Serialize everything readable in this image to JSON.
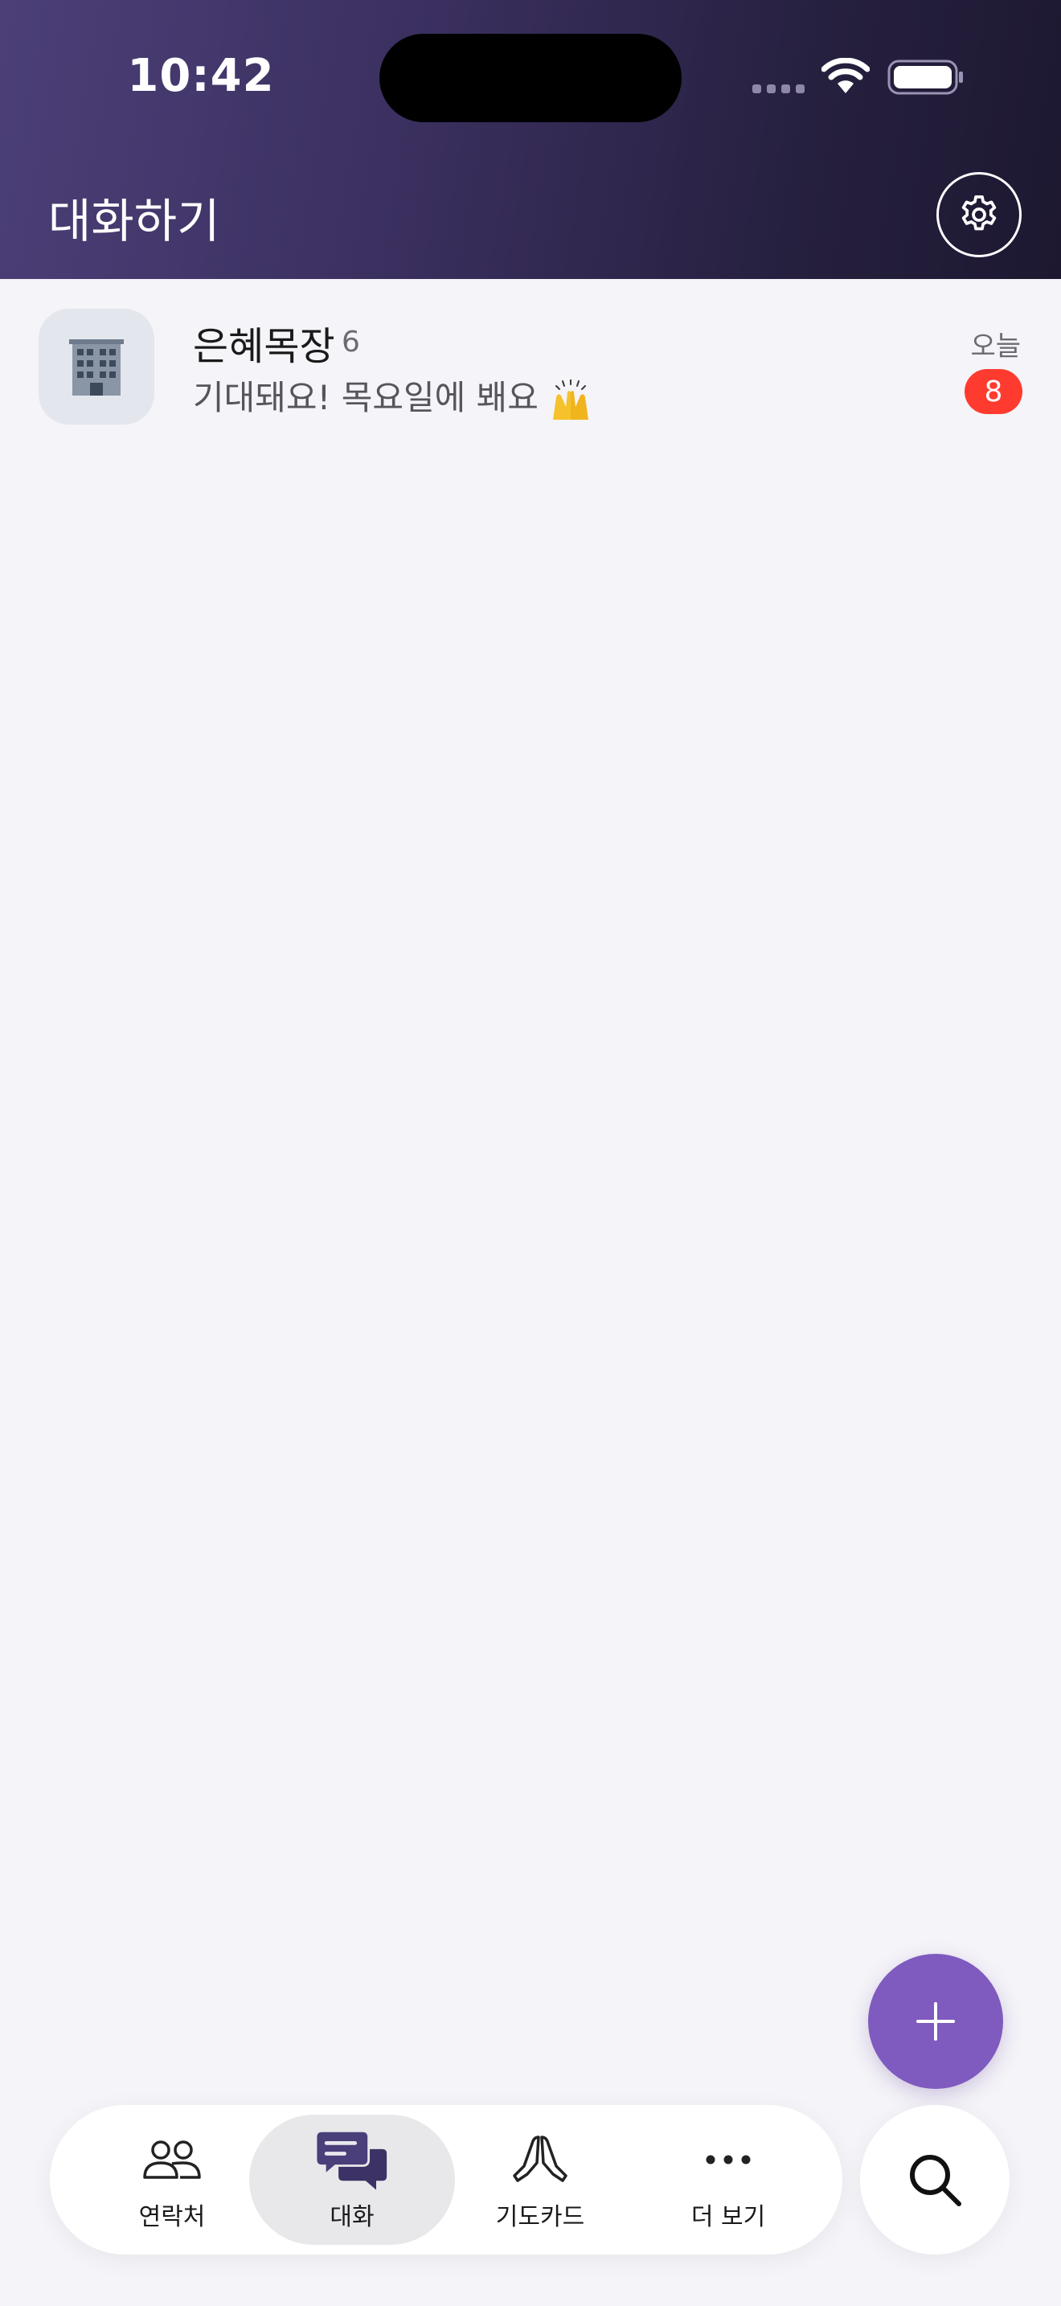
{
  "status_bar": {
    "time": "10:42"
  },
  "header": {
    "title": "대화하기",
    "settings_icon": "gear-icon"
  },
  "chats": [
    {
      "name": "은혜목장",
      "member_count": "6",
      "last_message": "기대돼요! 목요일에 봬요",
      "last_message_emoji": "raising-hands-icon",
      "time": "오늘",
      "unread": "8",
      "avatar_icon": "office-building-icon"
    }
  ],
  "fab": {
    "icon": "plus-icon"
  },
  "tabs": [
    {
      "label": "연락처",
      "icon": "people-icon",
      "active": false
    },
    {
      "label": "대화",
      "icon": "chat-bubbles-icon",
      "active": true
    },
    {
      "label": "기도카드",
      "icon": "praying-hands-icon",
      "active": false
    },
    {
      "label": "더 보기",
      "icon": "more-dots-icon",
      "active": false
    }
  ],
  "search": {
    "icon": "search-icon"
  },
  "colors": {
    "header_start": "#4c3f78",
    "header_end": "#1d1830",
    "accent": "#7f5abf",
    "badge": "#ff3b30",
    "background": "#f5f4f8"
  }
}
